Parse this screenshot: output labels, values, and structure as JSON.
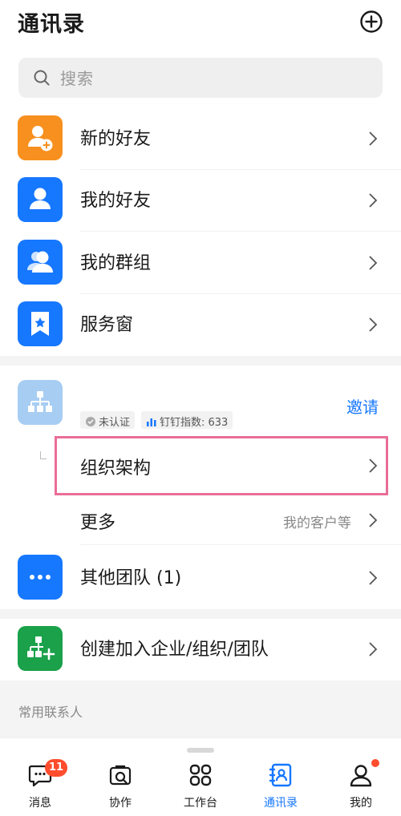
{
  "header": {
    "title": "通讯录"
  },
  "search": {
    "placeholder": "搜索"
  },
  "quick_items": [
    {
      "label": "新的好友",
      "icon": "add-friend-icon",
      "color": "#f7901e"
    },
    {
      "label": "我的好友",
      "icon": "person-icon",
      "color": "#1677ff"
    },
    {
      "label": "我的群组",
      "icon": "group-icon",
      "color": "#1677ff"
    },
    {
      "label": "服务窗",
      "icon": "bookmark-star-icon",
      "color": "#1677ff"
    }
  ],
  "org": {
    "invite_label": "邀请",
    "verify_badge": "未认证",
    "index_badge": "钉钉指数: 633",
    "structure_label": "组织架构",
    "more_label": "更多",
    "more_hint": "我的客户等"
  },
  "other_teams": {
    "label": "其他团队 (1)",
    "color": "#1677ff"
  },
  "create_org": {
    "label": "创建加入企业/组织/团队",
    "color": "#1aa14a"
  },
  "contacts_section": {
    "header": "常用联系人"
  },
  "tabbar": {
    "tabs": [
      {
        "label": "消息",
        "badge": "11"
      },
      {
        "label": "协作"
      },
      {
        "label": "工作台"
      },
      {
        "label": "通讯录",
        "active": true
      },
      {
        "label": "我的"
      }
    ],
    "active_color": "#1677ff"
  }
}
